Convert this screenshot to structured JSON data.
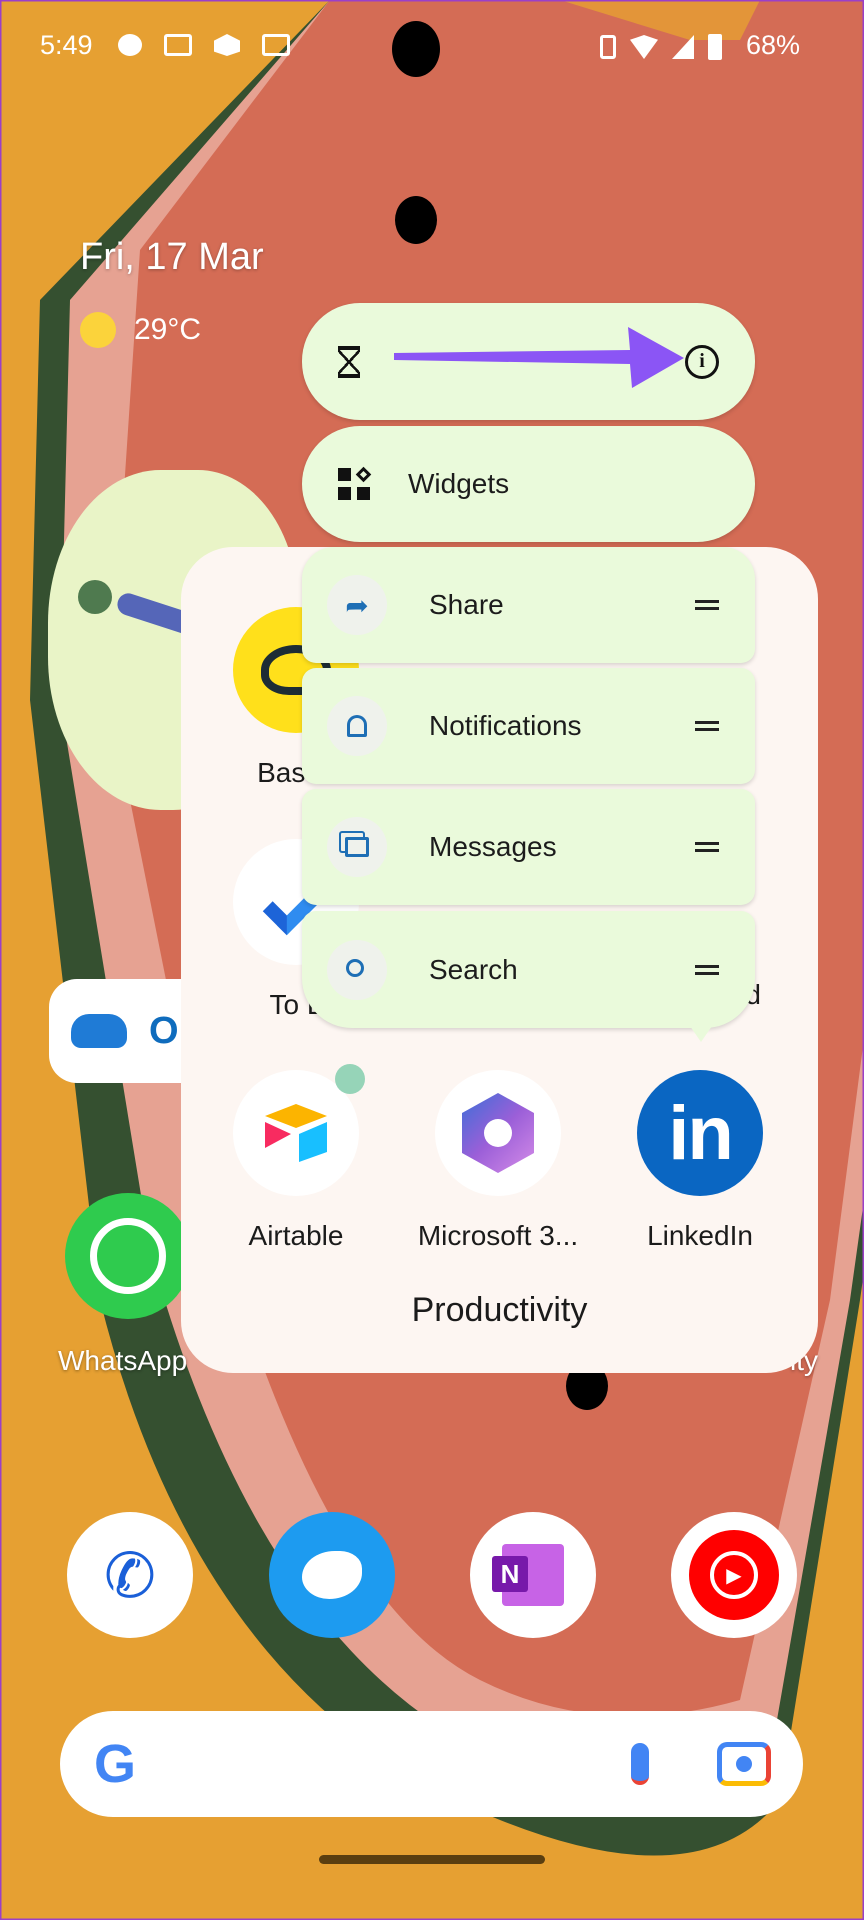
{
  "status_bar": {
    "time": "5:49",
    "battery": "68%",
    "left_icons": [
      "chat-bubble-icon",
      "outlook-icon",
      "airtable-icon",
      "outlook-icon"
    ],
    "right_icons": [
      "vibrate-icon",
      "wifi-icon",
      "signal-icon",
      "battery-icon"
    ]
  },
  "at_a_glance": {
    "date": "Fri, 17 Mar",
    "temperature": "29°C"
  },
  "popup": {
    "top_actions": [
      "hourglass-icon",
      "info-icon"
    ],
    "widgets_label": "Widgets",
    "shortcuts": [
      {
        "label": "Share",
        "icon": "share-icon"
      },
      {
        "label": "Notifications",
        "icon": "bell-icon"
      },
      {
        "label": "Messages",
        "icon": "messages-icon"
      },
      {
        "label": "Search",
        "icon": "search-icon"
      }
    ],
    "annotation_arrow_color": "#8B55F5"
  },
  "folder": {
    "name": "Productivity",
    "partial_labels": [
      "Basec",
      "To L",
      "rd"
    ],
    "apps": [
      {
        "label": "Airtable"
      },
      {
        "label": "Microsoft 3..."
      },
      {
        "label": "LinkedIn"
      }
    ]
  },
  "home": {
    "onedrive_partial": "O",
    "whatsapp_label": "WhatsApp",
    "partial_right_label": "ity"
  },
  "dock": [
    "phone-icon",
    "twitter-icon",
    "onenote-icon",
    "youtube-music-icon"
  ],
  "search_bar": {
    "icons": [
      "google-g-icon",
      "mic-icon",
      "lens-camera-icon"
    ]
  },
  "colors": {
    "popup_bg": "#EAFADB",
    "folder_bg": "#FDF6F2",
    "wallpaper": "#E6A032",
    "linkedin": "#0A66C2"
  }
}
